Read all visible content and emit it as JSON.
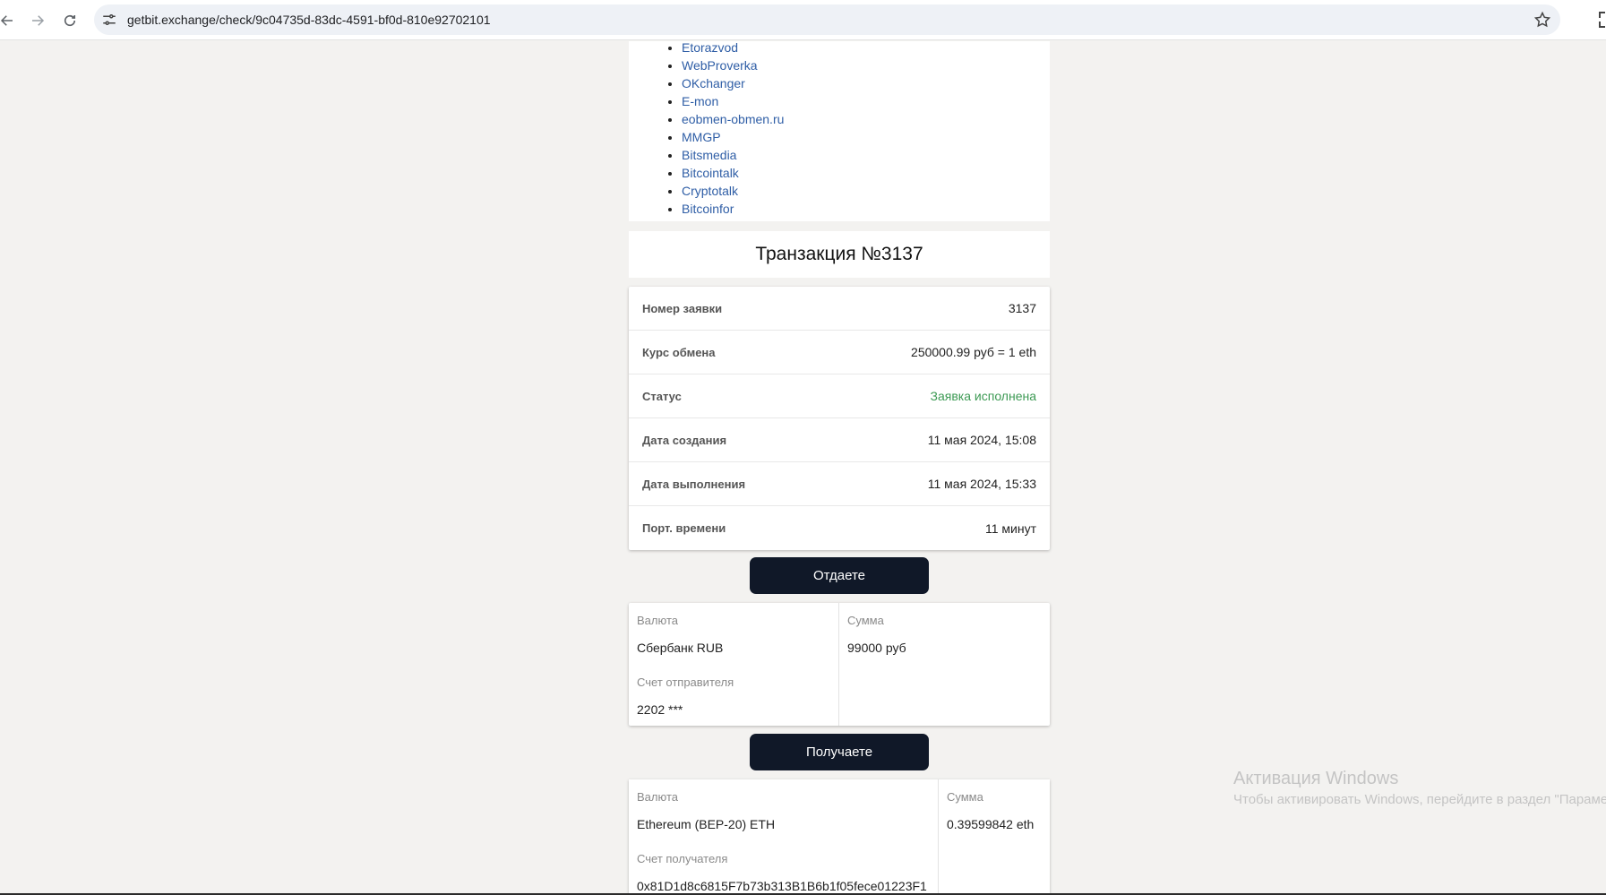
{
  "browser": {
    "url": "getbit.exchange/check/9c04735d-83dc-4591-bf0d-810e92702101"
  },
  "monitoring_links": [
    "Etorazvod",
    "WebProverka",
    "OKchanger",
    "E-mon",
    "eobmen-obmen.ru",
    "MMGP",
    "Bitsmedia",
    "Bitcointalk",
    "Cryptotalk",
    "Bitcoinfor"
  ],
  "transaction": {
    "title": "Транзакция №3137",
    "rows": [
      {
        "label": "Номер заявки",
        "value": "3137"
      },
      {
        "label": "Курс обмена",
        "value": "250000.99 руб = 1 eth"
      },
      {
        "label": "Статус",
        "value": "Заявка исполнена"
      },
      {
        "label": "Дата создания",
        "value": "11 мая 2024, 15:08"
      },
      {
        "label": "Дата выполнения",
        "value": "11 мая 2024, 15:33"
      },
      {
        "label": "Порт. времени",
        "value": "11 минут"
      }
    ],
    "status_color": "#3d9a54"
  },
  "give": {
    "button_label": "Отдаете",
    "currency_label": "Валюта",
    "currency": "Сбербанк RUB",
    "amount_label": "Сумма",
    "amount": "99000 руб",
    "account_label": "Счет отправителя",
    "account": "2202 ***"
  },
  "receive": {
    "button_label": "Получаете",
    "currency_label": "Валюта",
    "currency": "Ethereum (BEP-20) ETH",
    "amount_label": "Сумма",
    "amount": "0.39599842 eth",
    "account_label": "Счет получателя",
    "account": "0x81D1d8c6815F7b73b313B1B6b1f05fece01223F1"
  },
  "watermark": {
    "line1": "Активация Windows",
    "line2": "Чтобы активировать Windows, перейдите в раздел \"Параме"
  },
  "icons": {
    "back": "arrow-left-icon",
    "forward": "arrow-right-icon",
    "reload": "reload-icon",
    "site_info": "tune-icon",
    "bookmark": "star-icon"
  }
}
